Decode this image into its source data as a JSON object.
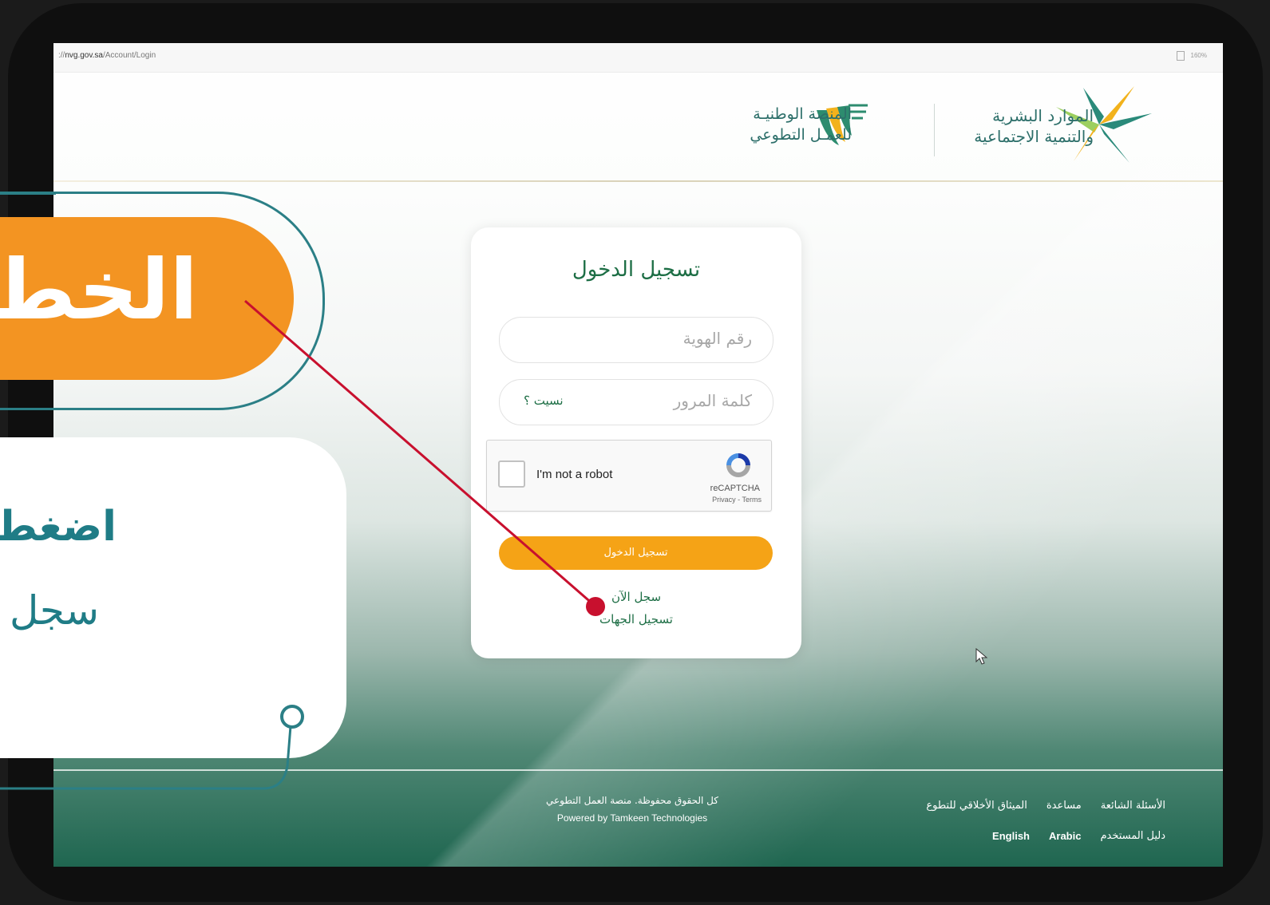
{
  "browser": {
    "url_prefix": "://",
    "url_domain": "nvg.gov.sa",
    "url_path": "/Account/Login",
    "zoom": "160%"
  },
  "header": {
    "nvw_logo_line1": "المنصة الوطنيـة",
    "nvw_logo_line2": "للعمـل التطوعي",
    "hrsd_logo_line1": "الموارد البشرية",
    "hrsd_logo_line2": "والتنمية الاجتماعية"
  },
  "login": {
    "title": "تسجيل الدخول",
    "id_placeholder": "رقم الهوية",
    "password_placeholder": "كلمة المرور",
    "forgot_label": "نسيت ؟",
    "captcha_label": "I'm not a robot",
    "captcha_brand": "reCAPTCHA",
    "captcha_terms": "Privacy - Terms",
    "submit_label": "تسجيل الدخول",
    "register_label": "سجل الآن",
    "orgs_register_label": "تسجيل الجهات"
  },
  "footer": {
    "copyright": "كل الحقوق محفوظة. منصة العمل التطوعي",
    "powered_by": "Powered by Tamkeen Technologies",
    "links": [
      "الأسئلة الشائعة",
      "مساعدة",
      "الميثاق الأخلاقي للتطوع"
    ],
    "links2": [
      "دليل المستخدم",
      "Arabic",
      "English"
    ]
  },
  "overlay": {
    "step_title": "الخط",
    "instruction_line1": "اضغط",
    "instruction_line2": "سجل"
  },
  "colors": {
    "brand_green": "#1d6e45",
    "accent_orange": "#f5a316",
    "overlay_teal": "#2b7f86",
    "annotation_red": "#c8102e"
  }
}
